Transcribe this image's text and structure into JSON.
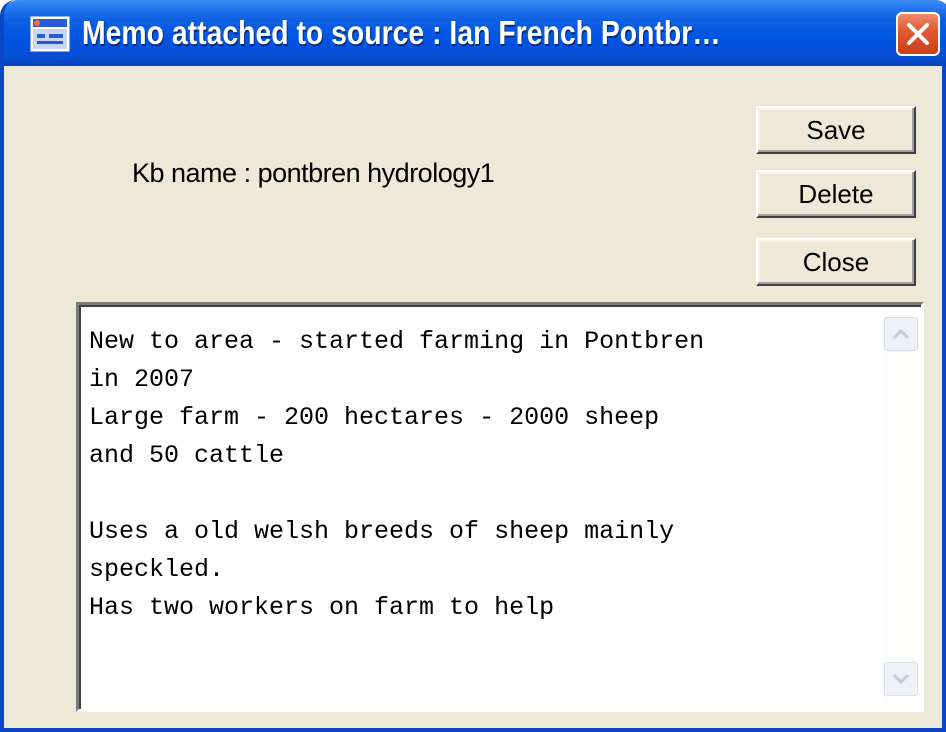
{
  "window": {
    "title": "Memo attached to source : Ian French Pontbr…"
  },
  "kb": {
    "label": "Kb name :  pontbren hydrology1"
  },
  "buttons": {
    "save": "Save",
    "delete": "Delete",
    "close": "Close"
  },
  "memo": {
    "text": "New to area - started farming in Pontbren\nin 2007\nLarge farm - 200 hectares - 2000 sheep\nand 50 cattle\n\nUses a old welsh breeds of sheep mainly\nspeckled.\nHas two workers on farm to help"
  },
  "colors": {
    "titlebar": "#0054e3",
    "window_bg": "#ece9d8",
    "close_button": "#e35b35"
  },
  "icons": {
    "app": "window-app-icon",
    "close": "close-icon",
    "scroll_up": "chevron-up-icon",
    "scroll_down": "chevron-down-icon"
  }
}
